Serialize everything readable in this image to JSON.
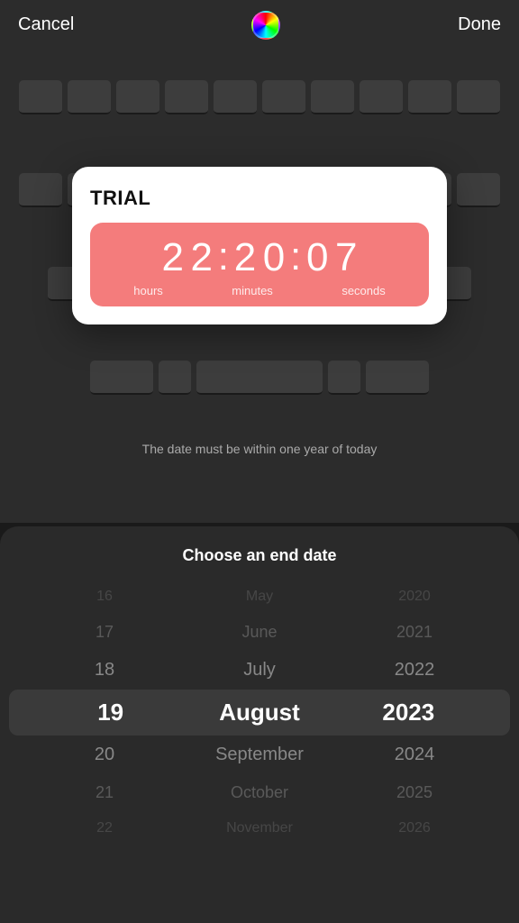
{
  "header": {
    "cancel_label": "Cancel",
    "done_label": "Done"
  },
  "card": {
    "title": "TRIAL",
    "timer": {
      "hours1": "2",
      "hours2": "2",
      "minutes1": "2",
      "minutes2": "0",
      "seconds1": "0",
      "seconds2": "7",
      "label_hours": "hours",
      "label_minutes": "minutes",
      "label_seconds": "seconds"
    }
  },
  "date_message": "The date must be within one year of today",
  "date_picker": {
    "title": "Choose an end date",
    "rows": [
      {
        "day": "16",
        "month": "May",
        "year": "2020",
        "state": "dim2"
      },
      {
        "day": "17",
        "month": "June",
        "year": "2021",
        "state": "dim1"
      },
      {
        "day": "18",
        "month": "July",
        "year": "2022",
        "state": "normal"
      },
      {
        "day": "19",
        "month": "August",
        "year": "2023",
        "state": "selected"
      },
      {
        "day": "20",
        "month": "September",
        "year": "2024",
        "state": "normal"
      },
      {
        "day": "21",
        "month": "October",
        "year": "2025",
        "state": "dim1"
      },
      {
        "day": "22",
        "month": "November",
        "year": "2026",
        "state": "dim2"
      }
    ]
  }
}
